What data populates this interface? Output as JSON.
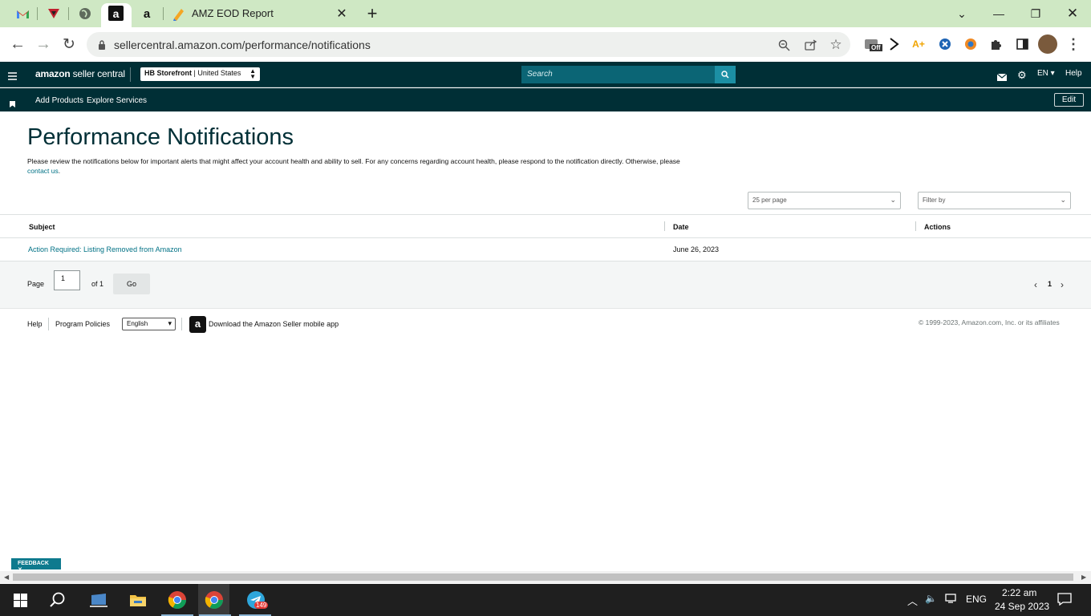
{
  "browser": {
    "tab_title": "AMZ EOD Report",
    "url": "sellercentral.amazon.com/performance/notifications"
  },
  "nav": {
    "logo_bold": "amazon",
    "logo_light": " seller central",
    "store_name": "HB Storefront",
    "store_region": "United States",
    "search_placeholder": "Search",
    "language": "EN",
    "help": "Help",
    "add_products": "Add Products",
    "explore_services": "Explore Services",
    "edit": "Edit"
  },
  "main": {
    "title": "Performance Notifications",
    "intro_text": "Please review the notifications below for important alerts that might affect your account health and ability to sell. For any concerns regarding account health, please respond to the notification directly. Otherwise, please ",
    "intro_link": "contact us",
    "intro_end": ".",
    "per_page": "25 per page",
    "filter_placeholder": "Filter by"
  },
  "table": {
    "headers": [
      "Subject",
      "Date",
      "Actions"
    ],
    "rows": [
      {
        "subject": "Action Required: Listing Removed from Amazon",
        "date": "June 26, 2023"
      }
    ]
  },
  "pager": {
    "page_label": "Page",
    "page_value": "1",
    "of_label": "of 1",
    "go": "Go",
    "current": "1"
  },
  "footer": {
    "help": "Help",
    "program_policies": "Program Policies",
    "language_option": "English",
    "download_app": "Download the Amazon Seller mobile app",
    "copyright": "© 1999-2023, Amazon.com, Inc. or its affiliates"
  },
  "feedback": "FEEDBACK",
  "taskbar": {
    "lang": "ENG",
    "time": "2:22 am",
    "date": "24 Sep 2023",
    "telegram_badge": "149"
  },
  "extension_badge": "Off"
}
